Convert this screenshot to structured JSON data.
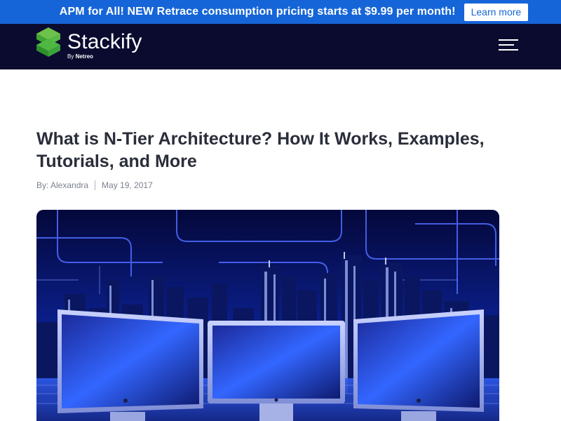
{
  "promo": {
    "text": "APM for All! NEW Retrace consumption pricing starts at $9.99 per month!",
    "button_label": "Learn more"
  },
  "header": {
    "brand": "Stackify",
    "by_prefix": "By",
    "by_company": "Netreo",
    "menu_icon": "hamburger-menu-icon"
  },
  "article": {
    "title": "What is N-Tier Architecture? How It Works, Examples, Tutorials, and More",
    "author": "By: Alexandra",
    "date": "May 19, 2017",
    "hero_image": "city-skyline-with-monitors-image"
  },
  "colors": {
    "promo_bg": "#1565d8",
    "nav_bg": "#0b0b30",
    "logo_green": "#3fb549",
    "title_text": "#2a2d3a"
  }
}
